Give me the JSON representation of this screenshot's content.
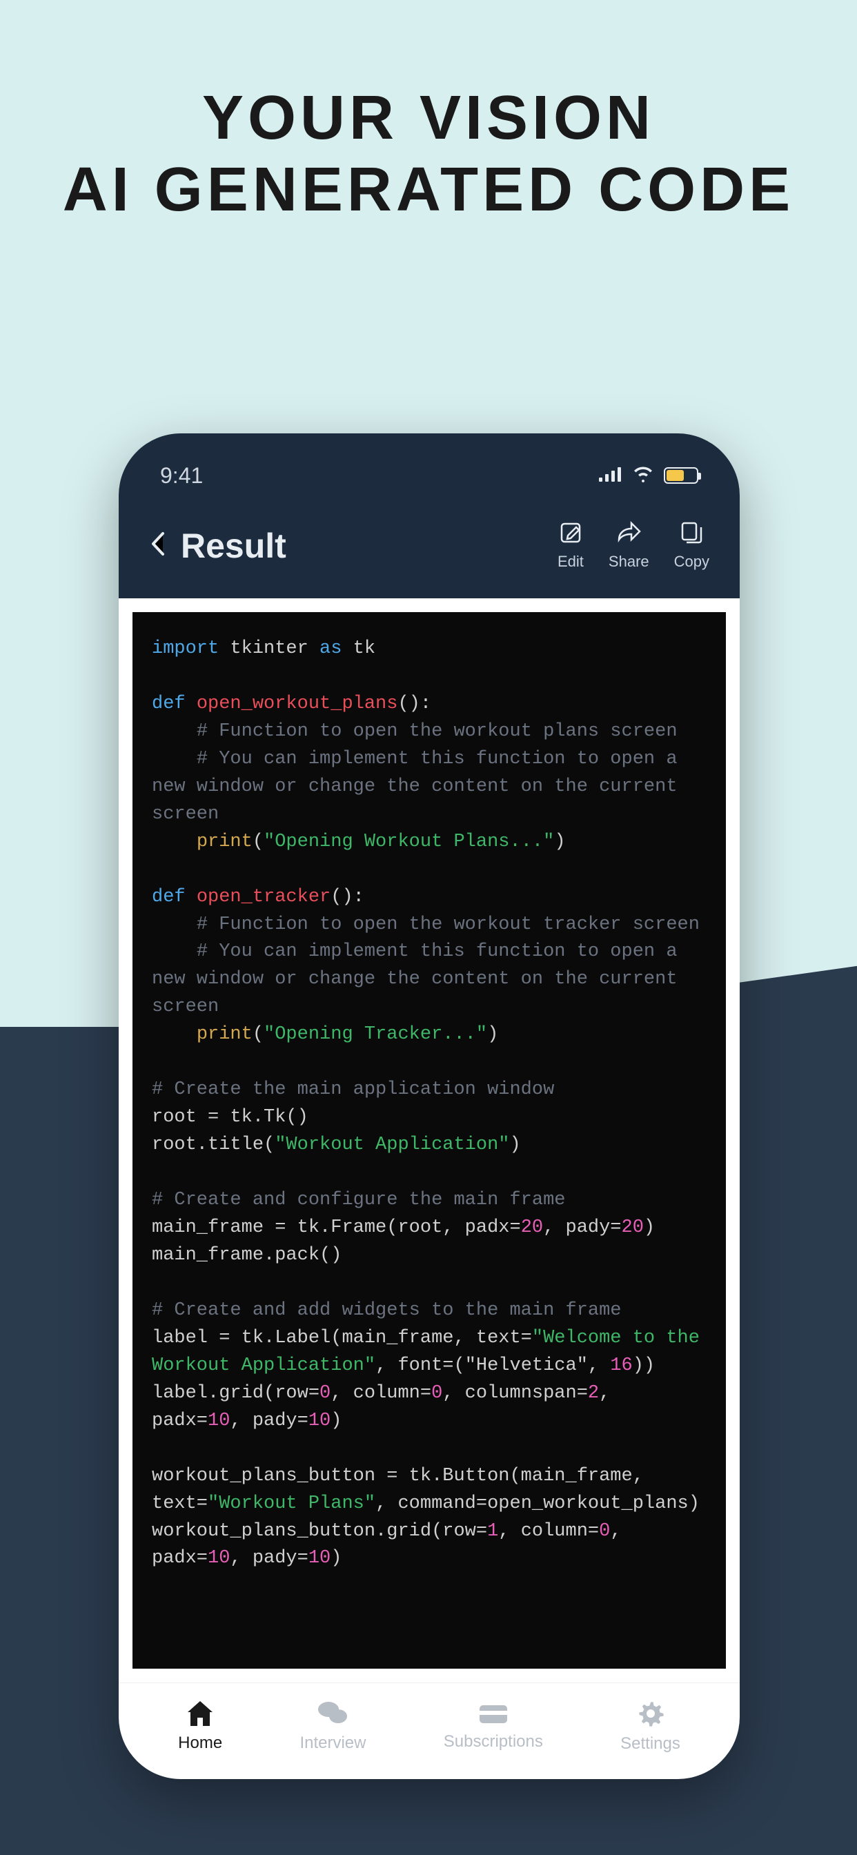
{
  "marketing": {
    "line1": "YOUR VISION",
    "line2": "AI GENERATED CODE"
  },
  "status": {
    "time": "9:41"
  },
  "header": {
    "title": "Result",
    "actions": {
      "edit": "Edit",
      "share": "Share",
      "copy": "Copy"
    }
  },
  "code": {
    "tokens": [
      {
        "t": "import ",
        "c": "kw-import"
      },
      {
        "t": "tkinter ",
        "c": ""
      },
      {
        "t": "as ",
        "c": "kw-as"
      },
      {
        "t": "tk",
        "c": ""
      },
      {
        "t": "\n\n",
        "c": ""
      },
      {
        "t": "def ",
        "c": "kw-def"
      },
      {
        "t": "open_workout_plans",
        "c": "fn-name"
      },
      {
        "t": "():",
        "c": ""
      },
      {
        "t": "\n",
        "c": ""
      },
      {
        "t": "    # Function to open the workout plans screen",
        "c": "comment"
      },
      {
        "t": "\n",
        "c": ""
      },
      {
        "t": "    # You can implement this function to open a new window or change the content on the current screen",
        "c": "comment"
      },
      {
        "t": "\n",
        "c": ""
      },
      {
        "t": "    ",
        "c": ""
      },
      {
        "t": "print",
        "c": "builtin"
      },
      {
        "t": "(",
        "c": ""
      },
      {
        "t": "\"Opening Workout Plans...\"",
        "c": "string"
      },
      {
        "t": ")",
        "c": ""
      },
      {
        "t": "\n\n",
        "c": ""
      },
      {
        "t": "def ",
        "c": "kw-def"
      },
      {
        "t": "open_tracker",
        "c": "fn-name"
      },
      {
        "t": "():",
        "c": ""
      },
      {
        "t": "\n",
        "c": ""
      },
      {
        "t": "    # Function to open the workout tracker screen",
        "c": "comment"
      },
      {
        "t": "\n",
        "c": ""
      },
      {
        "t": "    # You can implement this function to open a new window or change the content on the current screen",
        "c": "comment"
      },
      {
        "t": "\n",
        "c": ""
      },
      {
        "t": "    ",
        "c": ""
      },
      {
        "t": "print",
        "c": "builtin"
      },
      {
        "t": "(",
        "c": ""
      },
      {
        "t": "\"Opening Tracker...\"",
        "c": "string"
      },
      {
        "t": ")",
        "c": ""
      },
      {
        "t": "\n\n",
        "c": ""
      },
      {
        "t": "# Create the main application window",
        "c": "comment"
      },
      {
        "t": "\n",
        "c": ""
      },
      {
        "t": "root = tk.Tk()",
        "c": ""
      },
      {
        "t": "\n",
        "c": ""
      },
      {
        "t": "root.title(",
        "c": ""
      },
      {
        "t": "\"Workout Application\"",
        "c": "string"
      },
      {
        "t": ")",
        "c": ""
      },
      {
        "t": "\n\n",
        "c": ""
      },
      {
        "t": "# Create and configure the main frame",
        "c": "comment"
      },
      {
        "t": "\n",
        "c": ""
      },
      {
        "t": "main_frame = tk.Frame(root, padx=",
        "c": ""
      },
      {
        "t": "20",
        "c": "number"
      },
      {
        "t": ", pady=",
        "c": ""
      },
      {
        "t": "20",
        "c": "number"
      },
      {
        "t": ")",
        "c": ""
      },
      {
        "t": "\n",
        "c": ""
      },
      {
        "t": "main_frame.pack()",
        "c": ""
      },
      {
        "t": "\n\n",
        "c": ""
      },
      {
        "t": "# Create and add widgets to the main frame",
        "c": "comment"
      },
      {
        "t": "\n",
        "c": ""
      },
      {
        "t": "label = tk.Label(main_frame, text=",
        "c": ""
      },
      {
        "t": "\"Welcome to the Workout Application\"",
        "c": "string"
      },
      {
        "t": ", font=(",
        "c": ""
      },
      {
        "t": "\"Helvetica\"",
        "c": ""
      },
      {
        "t": ", ",
        "c": ""
      },
      {
        "t": "16",
        "c": "number"
      },
      {
        "t": "))",
        "c": ""
      },
      {
        "t": "\n",
        "c": ""
      },
      {
        "t": "label.grid(row=",
        "c": ""
      },
      {
        "t": "0",
        "c": "number"
      },
      {
        "t": ", column=",
        "c": ""
      },
      {
        "t": "0",
        "c": "number"
      },
      {
        "t": ", columnspan=",
        "c": ""
      },
      {
        "t": "2",
        "c": "number"
      },
      {
        "t": ", padx=",
        "c": ""
      },
      {
        "t": "10",
        "c": "number"
      },
      {
        "t": ", pady=",
        "c": ""
      },
      {
        "t": "10",
        "c": "number"
      },
      {
        "t": ")",
        "c": ""
      },
      {
        "t": "\n\n",
        "c": ""
      },
      {
        "t": "workout_plans_button = tk.Button(main_frame, text=",
        "c": ""
      },
      {
        "t": "\"Workout Plans\"",
        "c": "string"
      },
      {
        "t": ", command=open_workout_plans)",
        "c": ""
      },
      {
        "t": "\n",
        "c": ""
      },
      {
        "t": "workout_plans_button.grid(row=",
        "c": ""
      },
      {
        "t": "1",
        "c": "number"
      },
      {
        "t": ", column=",
        "c": ""
      },
      {
        "t": "0",
        "c": "number"
      },
      {
        "t": ", padx=",
        "c": ""
      },
      {
        "t": "10",
        "c": "number"
      },
      {
        "t": ", pady=",
        "c": ""
      },
      {
        "t": "10",
        "c": "number"
      },
      {
        "t": ")",
        "c": ""
      }
    ]
  },
  "nav": {
    "home": "Home",
    "interview": "Interview",
    "subscriptions": "Subscriptions",
    "settings": "Settings"
  }
}
